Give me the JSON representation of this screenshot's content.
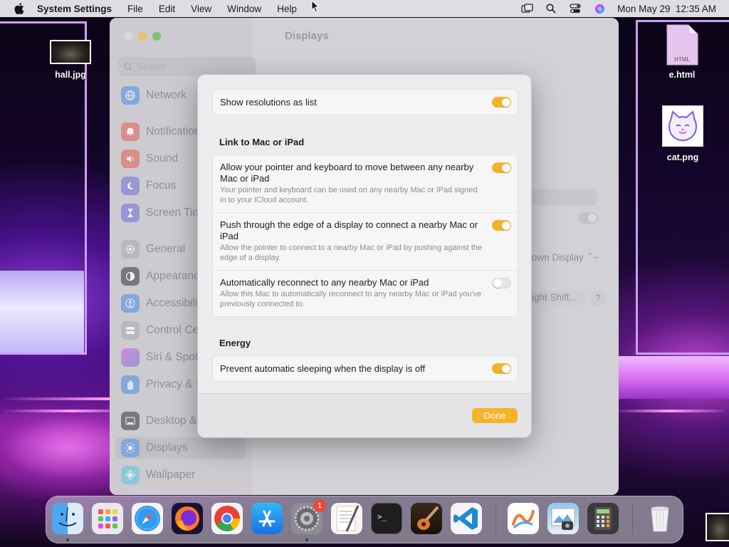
{
  "menubar": {
    "app_name": "System Settings",
    "menus": [
      "File",
      "Edit",
      "View",
      "Window",
      "Help"
    ],
    "clock": "Mon May 29  12:35 AM",
    "status_icons": [
      "screen-mirroring-icon",
      "spotlight-search-icon",
      "control-center-icon",
      "siri-icon"
    ]
  },
  "desktop": {
    "icons": [
      {
        "label": "hall.jpg",
        "kind": "image-thumbnail"
      },
      {
        "label": "e.html",
        "kind": "html-document"
      },
      {
        "label": "cat.png",
        "kind": "image-thumbnail"
      }
    ]
  },
  "settings_window": {
    "title": "Displays",
    "search_placeholder": "Search",
    "sidebar": [
      {
        "label": "Network",
        "icon": "globe-icon",
        "color": "#3b82f6"
      },
      {
        "label": "Notifications",
        "icon": "bell-icon",
        "color": "#ef4444"
      },
      {
        "label": "Sound",
        "icon": "speaker-icon",
        "color": "#ef4444"
      },
      {
        "label": "Focus",
        "icon": "moon-icon",
        "color": "#6366f1"
      },
      {
        "label": "Screen Time",
        "icon": "hourglass-icon",
        "color": "#6366f1"
      },
      {
        "label": "General",
        "icon": "gear-icon",
        "color": "#9ca3af"
      },
      {
        "label": "Appearance",
        "icon": "appearance-icon",
        "color": "#1f2937"
      },
      {
        "label": "Accessibility",
        "icon": "accessibility-icon",
        "color": "#3b82f6"
      },
      {
        "label": "Control Center",
        "icon": "control-center-icon",
        "color": "#9ca3af"
      },
      {
        "label": "Siri & Spotlight",
        "icon": "siri-icon",
        "color": "#a855f7"
      },
      {
        "label": "Privacy & Security",
        "icon": "hand-icon",
        "color": "#3b82f6"
      },
      {
        "label": "Desktop & Dock",
        "icon": "dock-icon",
        "color": "#1f2937"
      },
      {
        "label": "Displays",
        "icon": "sun-icon",
        "color": "#3b82f6"
      },
      {
        "label": "Wallpaper",
        "icon": "flower-icon",
        "color": "#22d3ee"
      }
    ],
    "background_fragments": {
      "display_dropdown": "own Display",
      "night_shift_button": "ight Shift...",
      "help_button": "?"
    }
  },
  "sheet": {
    "top_group": {
      "rows": [
        {
          "title": "Show resolutions as list",
          "enabled": true
        }
      ]
    },
    "link_section": {
      "heading": "Link to Mac or iPad",
      "rows": [
        {
          "title": "Allow your pointer and keyboard to move between any nearby Mac or iPad",
          "description": "Your pointer and keyboard can be used on any nearby Mac or iPad signed in to your iCloud account.",
          "enabled": true
        },
        {
          "title": "Push through the edge of a display to connect a nearby Mac or iPad",
          "description": "Allow the pointer to connect to a nearby Mac or iPad by pushing against the edge of a display.",
          "enabled": true
        },
        {
          "title": "Automatically reconnect to any nearby Mac or iPad",
          "description": "Allow this Mac to automatically reconnect to any nearby Mac or iPad you've previously connected to.",
          "enabled": false
        }
      ]
    },
    "energy_section": {
      "heading": "Energy",
      "rows": [
        {
          "title": "Prevent automatic sleeping when the display is off",
          "enabled": true
        }
      ]
    },
    "done_label": "Done",
    "accent_color": "#f5b32b"
  },
  "dock": {
    "apps": [
      {
        "name": "Finder",
        "icon": "finder-icon",
        "running": true
      },
      {
        "name": "Launchpad",
        "icon": "launchpad-icon",
        "running": false
      },
      {
        "name": "Safari",
        "icon": "safari-icon",
        "running": false
      },
      {
        "name": "Firefox",
        "icon": "firefox-icon",
        "running": false
      },
      {
        "name": "Chrome",
        "icon": "chrome-icon",
        "running": false
      },
      {
        "name": "App Store",
        "icon": "app-store-icon",
        "running": false
      },
      {
        "name": "System Settings",
        "icon": "system-settings-icon",
        "running": true,
        "badge": "1"
      },
      {
        "name": "TextEdit",
        "icon": "textedit-icon",
        "running": false
      },
      {
        "name": "Terminal",
        "icon": "terminal-icon",
        "running": false
      },
      {
        "name": "GarageBand",
        "icon": "garageband-icon",
        "running": false
      },
      {
        "name": "Visual Studio Code",
        "icon": "vscode-icon",
        "running": false
      },
      {
        "name": "Freeform",
        "icon": "freeform-icon",
        "running": false
      },
      {
        "name": "Preview",
        "icon": "preview-icon",
        "running": false
      },
      {
        "name": "Calculator",
        "icon": "calculator-icon",
        "running": false
      },
      {
        "name": "Trash",
        "icon": "trash-icon",
        "running": false
      }
    ]
  }
}
